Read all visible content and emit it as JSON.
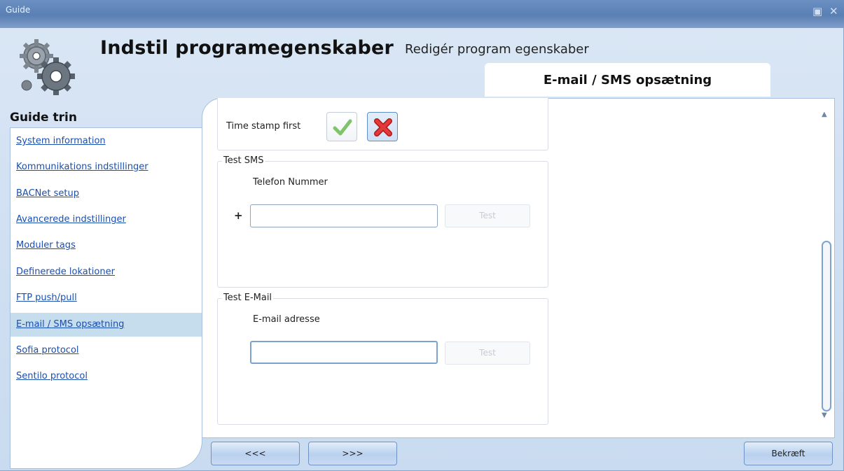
{
  "window": {
    "title": "Guide"
  },
  "header": {
    "title": "Indstil programegenskaber",
    "subtitle": "Redigér program egenskaber",
    "active_tab": "E-mail / SMS opsætning"
  },
  "sidebar": {
    "heading": "Guide trin",
    "items": [
      {
        "label": "System information"
      },
      {
        "label": "Kommunikations indstillinger"
      },
      {
        "label": "BACNet setup"
      },
      {
        "label": "Avancerede indstillinger"
      },
      {
        "label": "Moduler tags"
      },
      {
        "label": "Definerede lokationer"
      },
      {
        "label": "FTP push/pull"
      },
      {
        "label": "E-mail / SMS opsætning",
        "active": true
      },
      {
        "label": "Sofia protocol"
      },
      {
        "label": "Sentilo protocol"
      }
    ]
  },
  "content": {
    "time_stamp": {
      "label": "Time stamp first",
      "selected": "no"
    },
    "test_sms": {
      "legend": "Test SMS",
      "phone_label": "Telefon Nummer",
      "prefix": "+",
      "phone_value": "",
      "test_label": "Test"
    },
    "test_email": {
      "legend": "Test E-Mail",
      "email_label": "E-mail adresse",
      "email_value": "",
      "test_label": "Test"
    }
  },
  "footer": {
    "back_label": "<<<",
    "next_label": ">>>",
    "confirm_label": "Bekræft"
  },
  "colors": {
    "titlebar": "#5a7fb3",
    "accent": "#7da2cf",
    "link": "#1a4fb0",
    "active_nav": "#c6dded"
  },
  "icons": [
    "gears-icon",
    "checkmark-icon",
    "red-x-icon",
    "maximize-icon",
    "close-icon",
    "scroll-up-icon",
    "scroll-down-icon"
  ]
}
